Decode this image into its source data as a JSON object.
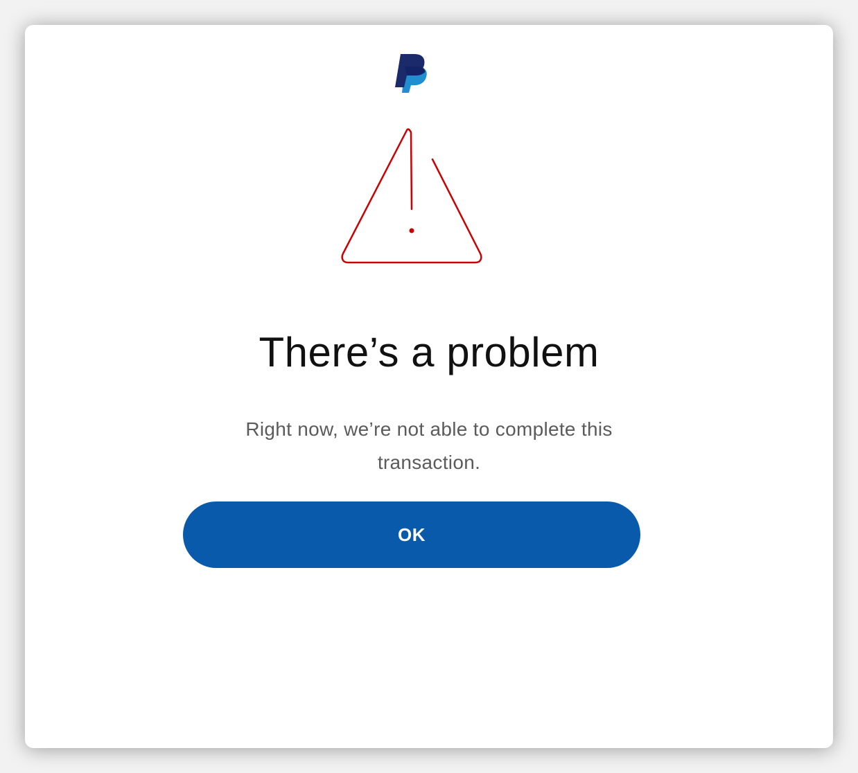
{
  "dialog": {
    "logo_icon": "paypal-logo",
    "alert_icon": "warning-triangle-icon",
    "title": "There’s a problem",
    "message": "Right now, we’re not able to complete this transaction.",
    "ok_label": "OK"
  },
  "colors": {
    "button_background": "#0a5aab",
    "button_text": "#ffffff",
    "warning_stroke": "#cc0000",
    "logo_dark": "#1b2a6b",
    "logo_light": "#1f8fd1",
    "title_text": "#111111",
    "message_text": "#5b5b5b"
  }
}
